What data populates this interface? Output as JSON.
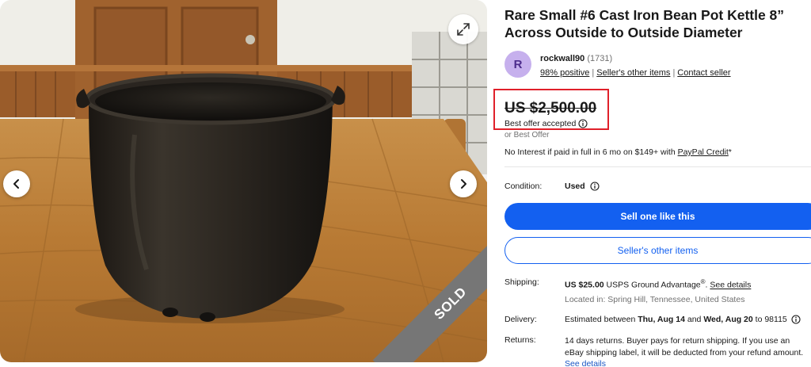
{
  "gallery": {
    "sold_label": "SOLD"
  },
  "listing": {
    "title": "Rare Small #6 Cast Iron Bean Pot Kettle 8” Across Outside to Outside Diameter"
  },
  "seller": {
    "avatar_initial": "R",
    "name": "rockwall90",
    "feedback_count": "(1731)",
    "positive": "98% positive",
    "other_items_link": "Seller's other items",
    "contact_link": "Contact seller",
    "avatar_color": "#c6b0ed"
  },
  "price": {
    "amount": "US $2,500.00",
    "best_offer_accepted": "Best offer accepted",
    "or_best_offer": "or Best Offer",
    "paypal_prefix": "No Interest if paid in full in 6 mo on $149+ with ",
    "paypal_link": "PayPal Credit",
    "paypal_suffix": "*",
    "highlight_color": "#e0202a"
  },
  "condition": {
    "label": "Condition:",
    "value": "Used"
  },
  "buttons": {
    "sell_one": "Sell one like this",
    "sellers_other": "Seller's other items",
    "primary_color": "#1360f0"
  },
  "shipping": {
    "label": "Shipping:",
    "price": "US $25.00",
    "service": "USPS Ground Advantage",
    "registered": "®",
    "see_details": "See details",
    "location": "Located in: Spring Hill, Tennessee, United States"
  },
  "delivery": {
    "label": "Delivery:",
    "prefix": "Estimated between ",
    "date1": "Thu, Aug 14",
    "and": " and ",
    "date2": "Wed, Aug 20",
    "to": " to 98115"
  },
  "returns": {
    "label": "Returns:",
    "text": "14 days returns. Buyer pays for return shipping. If you use an eBay shipping label, it will be deducted from your refund amount.",
    "see_details": "See details"
  }
}
